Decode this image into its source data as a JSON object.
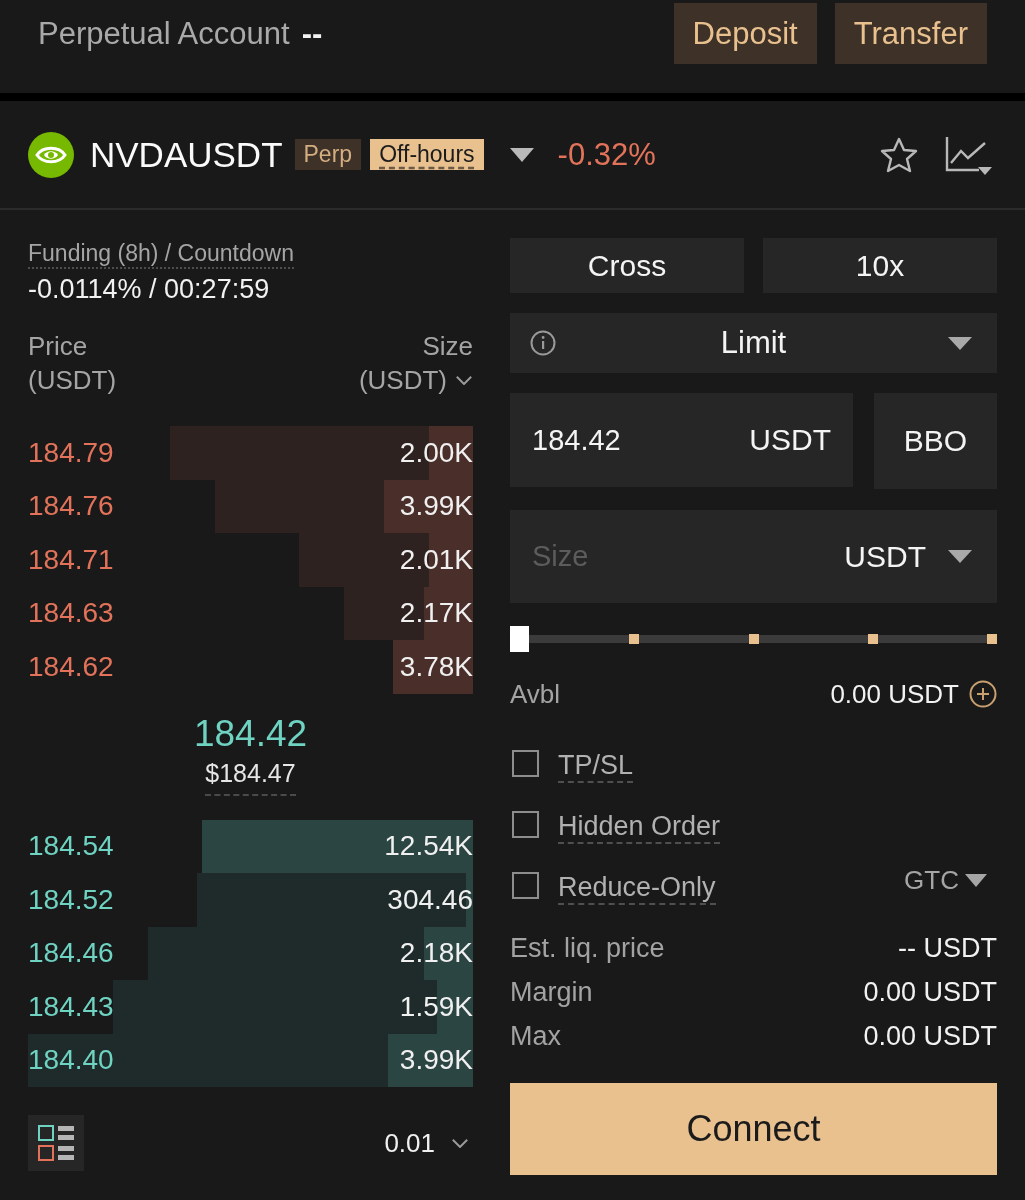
{
  "account_bar": {
    "label": "Perpetual Account",
    "value": "--",
    "buttons": [
      "Deposit",
      "Transfer"
    ]
  },
  "ticker": {
    "symbol": "NVDAUSDT",
    "tags": [
      {
        "label": "Perp",
        "kind": "plain"
      },
      {
        "label": "Off-hours",
        "kind": "highlight"
      }
    ],
    "change": {
      "value": "-0.32%",
      "negative": true
    }
  },
  "funding": {
    "label": "Funding (8h) / Countdown",
    "value": "-0.0114% / 00:27:59"
  },
  "order_book": {
    "columns": [
      {
        "label": "Price",
        "unit": "(USDT)"
      },
      {
        "label": "Size",
        "unit": "(USDT)"
      }
    ],
    "asks": [
      {
        "price": "184.79",
        "size": "2.00K",
        "level": 0.1,
        "depth": {
          "level": 0.68
        }
      },
      {
        "price": "184.76",
        "size": "3.99K",
        "level": 0.2,
        "depth": {
          "level": 0.58
        }
      },
      {
        "price": "184.71",
        "size": "2.01K",
        "level": 0.1,
        "depth": {
          "level": 0.39
        }
      },
      {
        "price": "184.63",
        "size": "2.17K",
        "level": 0.11,
        "depth": {
          "level": 0.29
        }
      },
      {
        "price": "184.62",
        "size": "3.78K",
        "level": 0.18,
        "depth": {
          "level": 0.18
        }
      }
    ],
    "mid_price": "184.42",
    "mark_price": "$184.47",
    "bids": [
      {
        "price": "184.54",
        "size": "12.54K",
        "level": 0.61,
        "depth": {
          "level": 0.61
        }
      },
      {
        "price": "184.52",
        "size": "304.46",
        "level": 0.016,
        "depth": {
          "level": 0.62
        }
      },
      {
        "price": "184.46",
        "size": "2.18K",
        "level": 0.11,
        "depth": {
          "level": 0.73
        }
      },
      {
        "price": "184.43",
        "size": "1.59K",
        "level": 0.08,
        "depth": {
          "level": 0.81
        }
      },
      {
        "price": "184.40",
        "size": "3.99K",
        "level": 0.19,
        "depth": {
          "level": 1
        }
      }
    ],
    "tick_size": "0.01"
  },
  "order_form": {
    "margin_mode": "Cross",
    "leverage": "10x",
    "order_type": "Limit",
    "price": {
      "value": "184.42",
      "unit": "USDT"
    },
    "bbo": "BBO",
    "size": {
      "placeholder": "Size",
      "unit": "USDT"
    },
    "slider": {
      "level": 0
    },
    "available": {
      "label": "Avbl",
      "value": "0.00 USDT"
    },
    "options": [
      {
        "label": "TP/SL",
        "checked": false
      },
      {
        "label": "Hidden Order",
        "checked": false
      },
      {
        "label": "Reduce-Only",
        "checked": false
      }
    ],
    "time_in_force": "GTC",
    "details": [
      {
        "label": "Est. liq. price",
        "value": "-- USDT"
      },
      {
        "label": "Margin",
        "value": "0.00 USDT"
      },
      {
        "label": "Max",
        "value": "0.00 USDT"
      }
    ],
    "submit": "Connect"
  }
}
